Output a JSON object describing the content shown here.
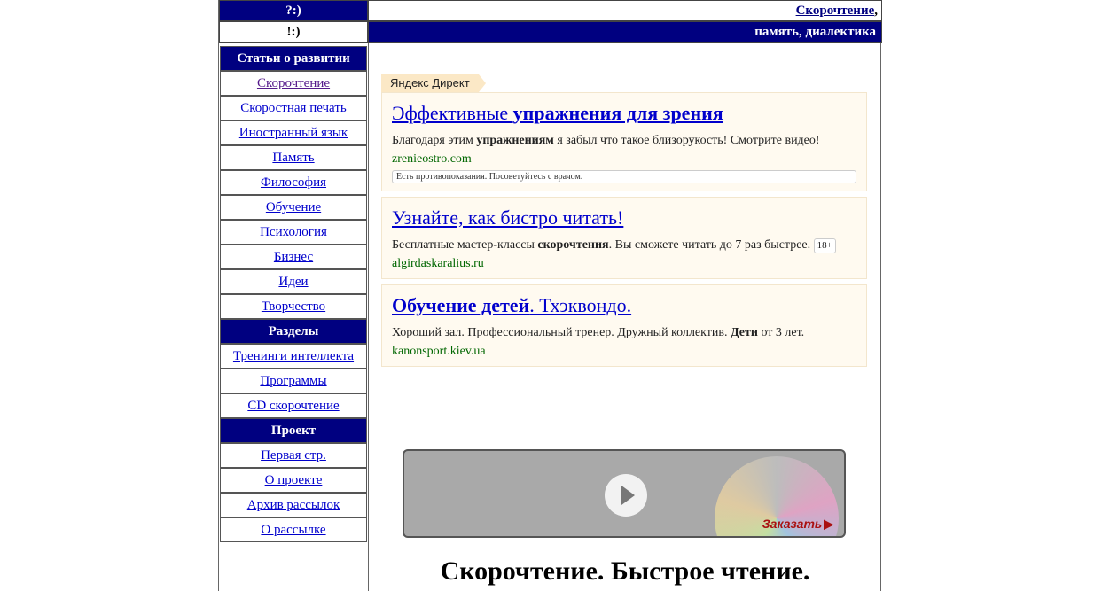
{
  "header": {
    "row1_left": "?:)",
    "row1_right_link": "Скорочтение",
    "row1_right_suffix": ",",
    "row2_left": "!:)",
    "row2_right": "память, диалектика"
  },
  "sidebar": {
    "sections": [
      {
        "title": "Статьи о развитии",
        "items": [
          "Скорочтение",
          "Скоростная печать",
          "Иностранный язык",
          "Память",
          "Философия",
          "Обучение",
          "Психология",
          "Бизнес",
          "Идеи",
          "Творчество"
        ]
      },
      {
        "title": "Разделы",
        "items": [
          "Тренинги интеллекта",
          "Программы",
          "CD скорочтение"
        ]
      },
      {
        "title": "Проект",
        "items": [
          "Первая стр.",
          "О проекте",
          "Архив рассылок",
          "О рассылке"
        ]
      }
    ]
  },
  "ads": {
    "tag": "Яндекс Директ",
    "items": [
      {
        "title_plain1": "Эффективные ",
        "title_bold": "упражнения для зрения",
        "title_plain2": "",
        "text_before": "Благодаря этим ",
        "text_bold": "упражнениям",
        "text_after": " я забыл что такое близорукость! Смотрите видео!",
        "url": "zrenieostro.com",
        "warning": "Есть противопоказания. Посоветуйтесь с врачом."
      },
      {
        "title_plain1": "Узнайте, как бистро читать!",
        "title_bold": "",
        "title_plain2": "",
        "text_before": "Бесплатные мастер-классы ",
        "text_bold": "скорочтения",
        "text_after": ". Вы сможете читать до 7 раз быстрее. ",
        "age": "18+",
        "url": "algirdaskaralius.ru"
      },
      {
        "title_plain1": "",
        "title_bold": "Обучение детей",
        "title_plain2": ". Тхэквондо.",
        "text_before": "Хороший зал. Профессиональный тренер. Дружный коллектив. ",
        "text_bold": "Дети",
        "text_after": " от 3 лет.",
        "url": "kanonsport.kiev.ua"
      }
    ]
  },
  "video": {
    "order_label": "Заказать"
  },
  "headline": "Скорочтение. Быстрое чтение.",
  "colors": {
    "navy": "#000080",
    "link": "#0000cc",
    "ad_bg": "#fffaf0",
    "ad_url": "#006600"
  }
}
